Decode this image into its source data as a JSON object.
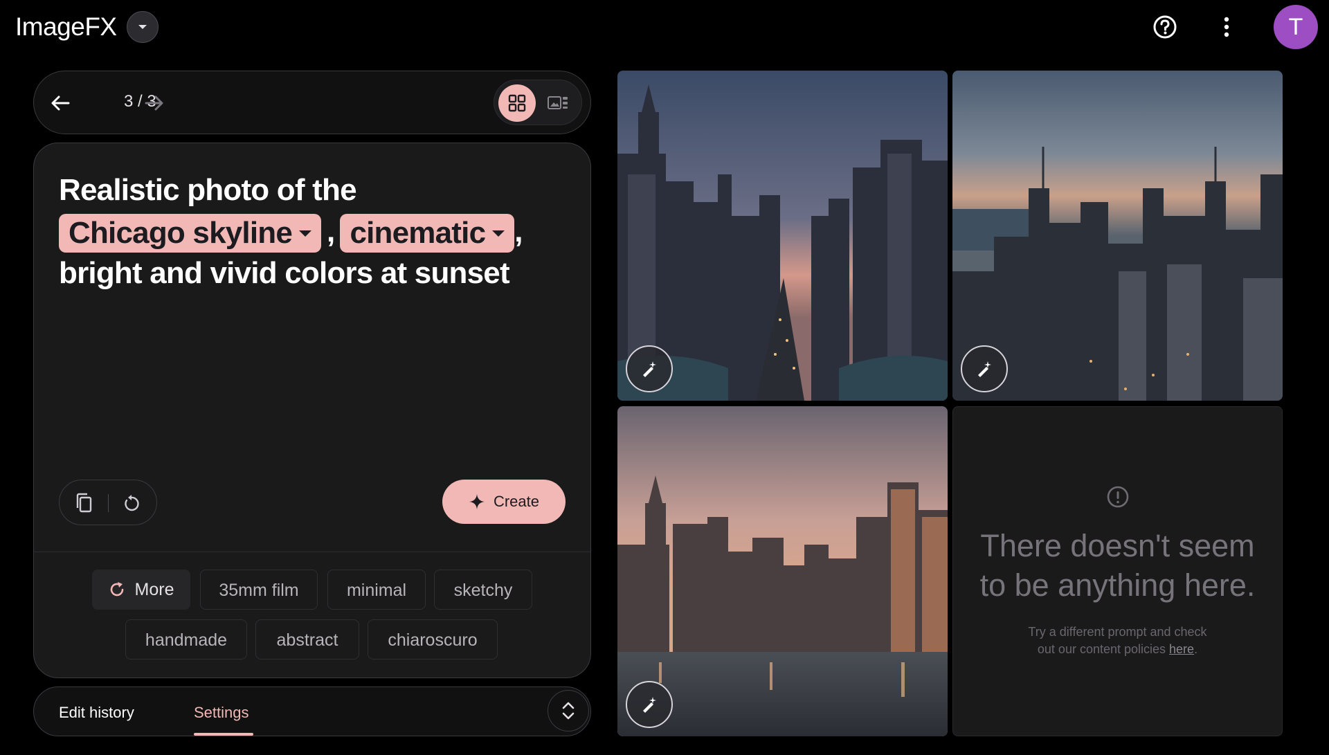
{
  "header": {
    "app_title": "ImageFX",
    "avatar_initial": "T",
    "icons": [
      "chevron-down-icon",
      "help-icon",
      "more-vert-icon"
    ]
  },
  "nav": {
    "page_indicator": "3 / 3",
    "icons": [
      "arrow-back-icon",
      "arrow-forward-icon",
      "grid-view-icon",
      "single-view-icon"
    ]
  },
  "prompt": {
    "line1": "Realistic photo of the",
    "chip1": "Chicago skyline",
    "comma1": ",",
    "chip2": "cinematic",
    "comma2": ",",
    "line3": "bright and vivid colors at sunset"
  },
  "actions": {
    "create_label": "Create"
  },
  "suggestions": {
    "more_label": "More",
    "tags": [
      "35mm film",
      "minimal",
      "sketchy",
      "handmade",
      "abstract",
      "chiaroscuro"
    ]
  },
  "tabs": {
    "edit_history": "Edit history",
    "settings": "Settings"
  },
  "empty_state": {
    "title_line1": "There doesn't seem",
    "title_line2": "to be anything here.",
    "sub_line1": "Try a different prompt and check",
    "sub_line2_prefix": "out our content policies ",
    "sub_link": "here",
    "sub_suffix": "."
  },
  "colors": {
    "accent": "#f2b8b5",
    "avatar": "#9c4ec2",
    "background": "#000000",
    "card": "#1a1a1b"
  }
}
